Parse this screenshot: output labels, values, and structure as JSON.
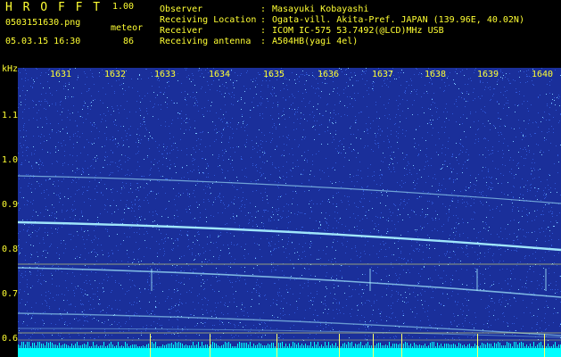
{
  "app": {
    "title": "H R O F F T",
    "version": "1.00"
  },
  "file": {
    "name": "0503151630.png",
    "date": "05.03.15 16:30"
  },
  "detection": {
    "label": "meteor",
    "count": "86"
  },
  "station": [
    {
      "label": "Observer",
      "value": "Masayuki Kobayashi"
    },
    {
      "label": "Receiving Location",
      "value": "Ogata-vill. Akita-Pref. JAPAN (139.96E, 40.02N)"
    },
    {
      "label": "Receiver",
      "value": "ICOM IC-575 53.7492(@LCD)MHz USB"
    },
    {
      "label": "Receiving antenna",
      "value": "A504HB(yagi 4el)"
    }
  ],
  "axes": {
    "y_unit": "kHz",
    "y_ticks": [
      "1.1",
      "1.0",
      "0.9",
      "0.8",
      "0.7",
      "0.6"
    ],
    "x_ticks": [
      "1631",
      "1632",
      "1633",
      "1634",
      "1635",
      "1636",
      "1637",
      "1638",
      "1639",
      "1640"
    ]
  },
  "colors": {
    "text": "#ffff33",
    "background": "#1a2f9a",
    "noise": "#2f57d6",
    "signal": "#7ec8ff",
    "trace": "#a8f0ff",
    "marker": "#ffff66",
    "bottom_bar": "#00ffff"
  }
}
